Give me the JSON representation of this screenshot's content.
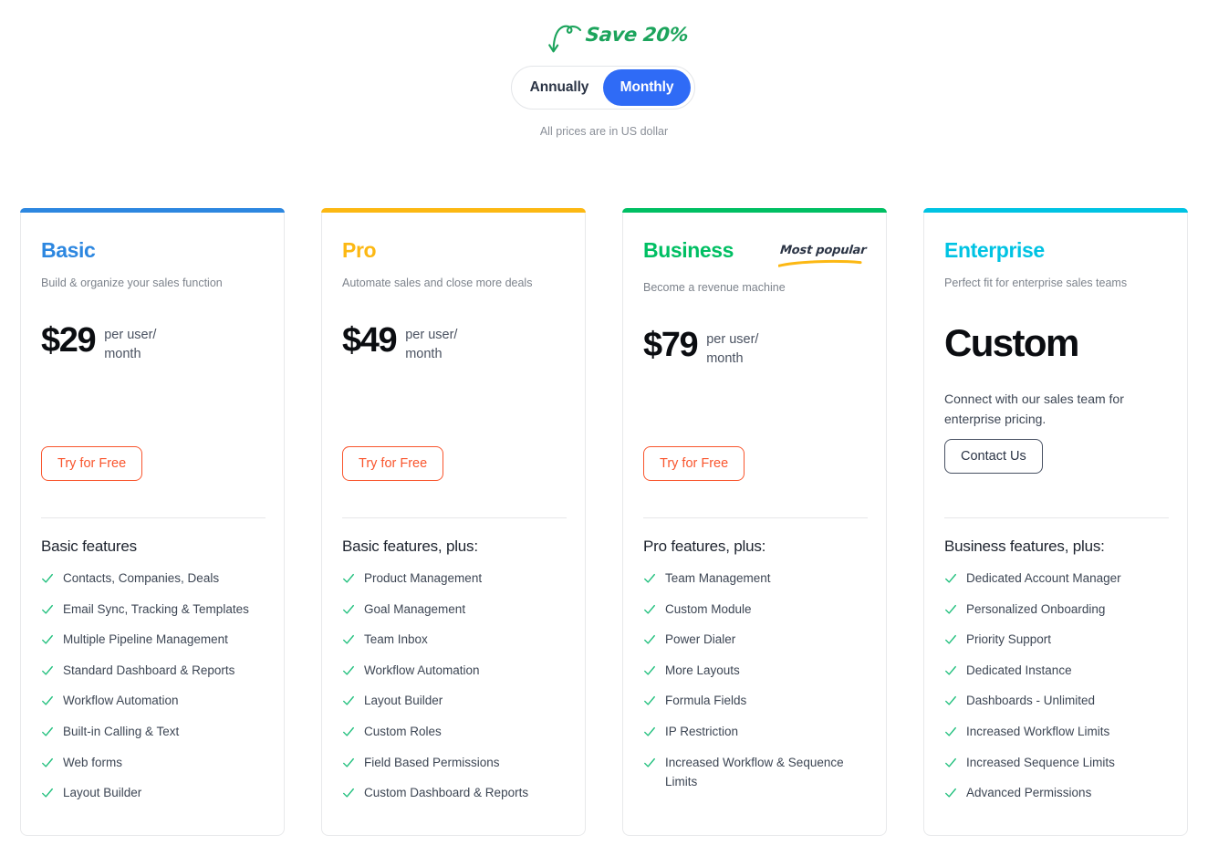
{
  "billing": {
    "save_badge": "Save 20%",
    "save_color": "#1ca45c",
    "options": [
      {
        "label": "Annually",
        "active": false
      },
      {
        "label": "Monthly",
        "active": true
      }
    ],
    "active_color": "#2f6bf6",
    "currency_note": "All prices are in US dollar"
  },
  "plans": [
    {
      "name": "Basic",
      "accent": "#2d87e0",
      "description": "Build & organize your sales function",
      "price": "$29",
      "price_unit": "per user/\nmonth",
      "cta": {
        "label": "Try for Free",
        "style": "try"
      },
      "features_title": "Basic features",
      "features": [
        "Contacts, Companies, Deals",
        "Email Sync, Tracking & Templates",
        "Multiple Pipeline Management",
        "Standard Dashboard & Reports",
        "Workflow Automation",
        "Built-in Calling & Text",
        "Web forms",
        "Layout Builder"
      ]
    },
    {
      "name": "Pro",
      "accent": "#fcb813",
      "description": "Automate sales and close more deals",
      "price": "$49",
      "price_unit": "per user/\nmonth",
      "cta": {
        "label": "Try for Free",
        "style": "try"
      },
      "features_title": "Basic features, plus:",
      "features": [
        "Product Management",
        "Goal Management",
        "Team Inbox",
        "Workflow Automation",
        "Layout Builder",
        "Custom Roles",
        "Field Based Permissions",
        "Custom Dashboard & Reports"
      ]
    },
    {
      "name": "Business",
      "accent": "#00bf63",
      "badge": "Most popular",
      "description": "Become a revenue machine",
      "price": "$79",
      "price_unit": "per user/\nmonth",
      "cta": {
        "label": "Try for Free",
        "style": "try"
      },
      "features_title": "Pro features, plus:",
      "features": [
        "Team Management",
        "Custom Module",
        "Power Dialer",
        "More Layouts",
        "Formula Fields",
        "IP Restriction",
        "Increased Workflow & Sequence Limits"
      ]
    },
    {
      "name": "Enterprise",
      "accent": "#00c3e3",
      "description": "Perfect fit for enterprise sales teams",
      "price": "Custom",
      "custom_note": "Connect with our sales team for enterprise pricing.",
      "cta": {
        "label": "Contact Us",
        "style": "contact"
      },
      "features_title": "Business features, plus:",
      "features": [
        "Dedicated Account Manager",
        "Personalized Onboarding",
        "Priority Support",
        "Dedicated Instance",
        "Dashboards - Unlimited",
        "Increased Workflow Limits",
        "Increased Sequence Limits",
        "Advanced Permissions"
      ]
    }
  ],
  "icons": {
    "check": "check-icon",
    "save_arrow": "curved-arrow-icon",
    "popular_underline": "underline-swoosh-icon"
  }
}
